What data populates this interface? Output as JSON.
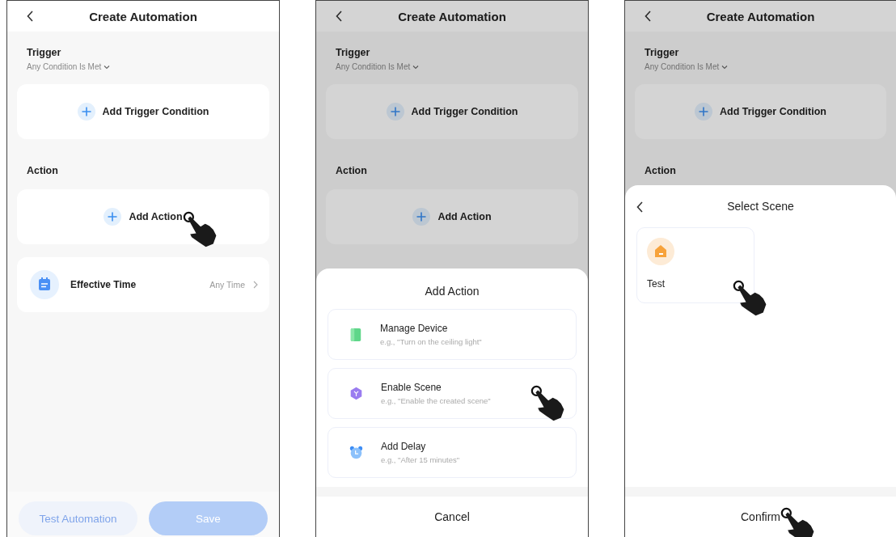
{
  "screens": [
    {
      "title": "Create Automation",
      "trigger": {
        "label": "Trigger",
        "mode": "Any Condition Is Met",
        "add_label": "Add Trigger Condition"
      },
      "action": {
        "label": "Action",
        "add_label": "Add Action",
        "tapped": true
      },
      "effective_time": {
        "label": "Effective Time",
        "value": "Any Time"
      },
      "buttons": [
        {
          "label": "Test Automation",
          "kind": "secondary",
          "disabled": true
        },
        {
          "label": "Save",
          "kind": "primary",
          "disabled": true
        }
      ]
    },
    {
      "title": "Create Automation",
      "trigger": {
        "label": "Trigger",
        "mode": "Any Condition Is Met",
        "add_label": "Add Trigger Condition"
      },
      "action": {
        "label": "Action",
        "add_label": "Add Action"
      },
      "sheet": {
        "kind": "add_action",
        "title": "Add Action",
        "options": [
          {
            "kind": "device",
            "title": "Manage Device",
            "hint": "e.g., \"Turn on the ceiling light\"",
            "tapped": false
          },
          {
            "kind": "scene",
            "title": "Enable Scene",
            "hint": "e.g., \"Enable the created scene\"",
            "tapped": true
          },
          {
            "kind": "delay",
            "title": "Add Delay",
            "hint": "e.g., \"After 15 minutes\"",
            "tapped": false
          }
        ],
        "footer": {
          "label": "Cancel"
        }
      }
    },
    {
      "title": "Create Automation",
      "trigger": {
        "label": "Trigger",
        "mode": "Any Condition Is Met",
        "add_label": "Add Trigger Condition"
      },
      "action": {
        "label": "Action"
      },
      "sheet": {
        "kind": "select_scene",
        "title": "Select Scene",
        "scenes": [
          {
            "name": "Test",
            "tapped": true
          }
        ],
        "footer": {
          "label": "Confirm",
          "tapped": true
        }
      }
    }
  ]
}
